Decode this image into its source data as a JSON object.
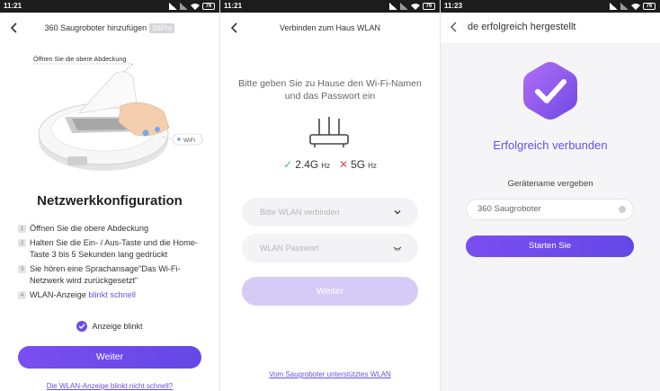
{
  "colors": {
    "accent": "#6b4ee6",
    "button": "#7a4ef0",
    "button_disabled": "#d6cbf7",
    "success_check": "#4ab98a",
    "fail_x": "#e24b4b",
    "statusbar": "#1c1c1c"
  },
  "screen1": {
    "status_time": "11:21",
    "battery": "76",
    "title": "360 Saugroboter hinzufügen",
    "model_badge": "S6Pro",
    "cover_callout": "Öffnen Sie die obere Abdeckung",
    "wifi_tag": "WiFi",
    "heading": "Netzwerkkonfiguration",
    "steps": [
      {
        "num": "1",
        "text": "Öffnen Sie die obere Abdeckung"
      },
      {
        "num": "2",
        "text": "Halten Sie die Ein- / Aus-Taste und die Home-Taste 3 bis 5 Sekunden lang gedrückt"
      },
      {
        "num": "3",
        "text": "Sie hören eine Sprachansage\"Das Wi-Fi-Netzwerk wird zurückgesetzt\""
      },
      {
        "num": "4",
        "text": "WLAN-Anzeige ",
        "highlight": "blinkt schnell"
      }
    ],
    "checkbox_label": "Anzeige blinkt",
    "checkbox_checked": true,
    "next_button": "Weiter",
    "help_link": "Die WLAN-Anzeige blinkt nicht schnell?"
  },
  "screen2": {
    "status_time": "11:21",
    "battery": "76",
    "title": "Verbinden zum Haus WLAN",
    "instruction": "Bitte geben Sie zu Hause den Wi-Fi-Namen und das Passwort ein",
    "band_supported": {
      "value": "2.4G",
      "unit": "Hz"
    },
    "band_unsupported": {
      "value": "5G",
      "unit": "Hz"
    },
    "wlan_placeholder": "Bitte WLAN verbinden",
    "password_placeholder": "WLAN Passwort",
    "next_button": "Weiter",
    "supported_wlan_link": "Vom Saugroboter unterstütztes WLAN"
  },
  "screen3": {
    "status_time": "11:23",
    "battery": "76",
    "title": "de erfolgreich hergestellt",
    "success_text": "Erfolgreich verbunden",
    "name_label": "Gerätename vergeben",
    "device_name": "360 Saugroboter",
    "start_button": "Starten Sie"
  }
}
